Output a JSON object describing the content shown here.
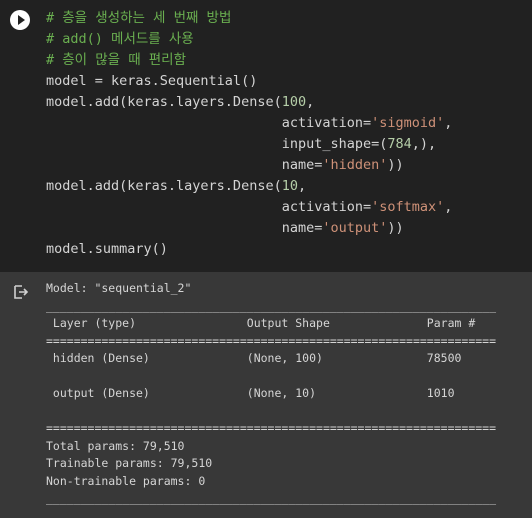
{
  "code_cell": {
    "lines": [
      "# 층을 생성하는 세 번째 방법",
      "# add() 메서드를 사용",
      "# 층이 많을 때 편리함",
      "model = keras.Sequential()",
      "model.add(keras.layers.Dense(100,",
      "                             activation='sigmoid',",
      "                             input_shape=(784,),",
      "                             name='hidden'))",
      "model.add(keras.layers.Dense(10,",
      "                             activation='softmax',",
      "                             name='output'))",
      "model.summary()"
    ]
  },
  "output": {
    "model_line": "Model: \"sequential_2\"",
    "rule": "_________________________________________________________________",
    "header": " Layer (type)                Output Shape              Param #   ",
    "double_rule": "=================================================================",
    "rows": [
      " hidden (Dense)              (None, 100)               78500     ",
      "",
      " output (Dense)              (None, 10)                1010      ",
      ""
    ],
    "total": "Total params: 79,510",
    "trainable": "Trainable params: 79,510",
    "non_trainable": "Non-trainable params: 0"
  },
  "icons": {
    "run": "play-circle-icon",
    "output": "output-redirect-icon"
  },
  "colors": {
    "code_bg": "#212121",
    "output_bg": "#383838",
    "comment": "#6aaf50",
    "string": "#ce9178",
    "number": "#b5cea8"
  }
}
